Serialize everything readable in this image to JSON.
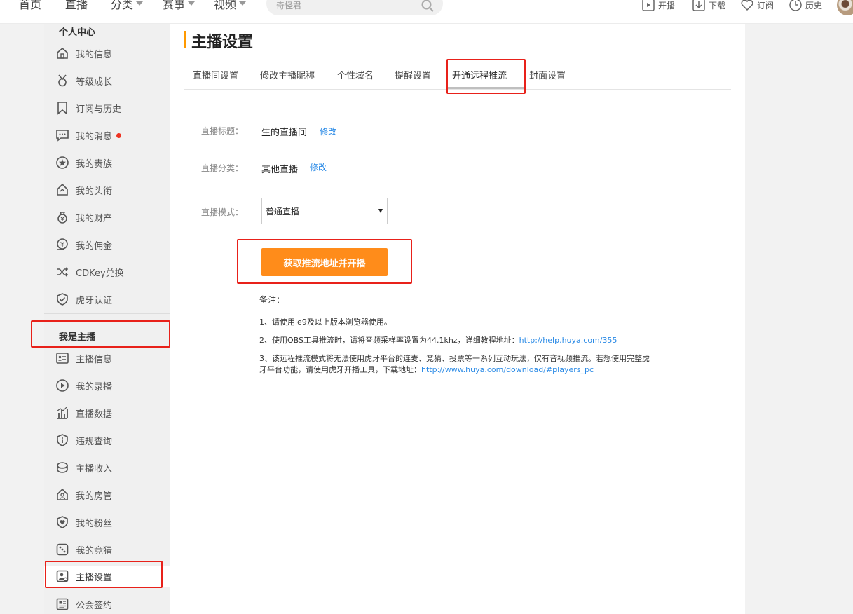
{
  "topnav": {
    "home": "首页",
    "live": "直播",
    "category": "分类",
    "events": "赛事",
    "video": "视频",
    "search_placeholder": "奇怪君",
    "start_live": "开播",
    "download": "下载",
    "subscribe": "订阅",
    "history": "历史"
  },
  "sidebar": {
    "personal_title": "个人中心",
    "personal_items": [
      {
        "label": "我的信息",
        "icon": "home-icon"
      },
      {
        "label": "等级成长",
        "icon": "medal-icon"
      },
      {
        "label": "订阅与历史",
        "icon": "bookmark-icon"
      },
      {
        "label": "我的消息",
        "icon": "message-icon"
      },
      {
        "label": "我的贵族",
        "icon": "star-icon"
      },
      {
        "label": "我的头衔",
        "icon": "house-icon"
      },
      {
        "label": "我的财产",
        "icon": "moneybag-icon"
      },
      {
        "label": "我的佣金",
        "icon": "commission-icon"
      },
      {
        "label": "CDKey兑换",
        "icon": "shuffle-icon"
      },
      {
        "label": "虎牙认证",
        "icon": "shield-check-icon"
      }
    ],
    "streamer_title": "我是主播",
    "streamer_items": [
      {
        "label": "主播信息",
        "icon": "id-card-icon"
      },
      {
        "label": "我的录播",
        "icon": "play-icon"
      },
      {
        "label": "直播数据",
        "icon": "bar-chart-icon"
      },
      {
        "label": "违规查询",
        "icon": "info-icon"
      },
      {
        "label": "主播收入",
        "icon": "income-icon"
      },
      {
        "label": "我的房管",
        "icon": "house-manager-icon"
      },
      {
        "label": "我的粉丝",
        "icon": "heart-shield-icon"
      },
      {
        "label": "我的竞猜",
        "icon": "dice-icon"
      },
      {
        "label": "主播设置",
        "icon": "user-settings-icon"
      },
      {
        "label": "公会签约",
        "icon": "contract-icon"
      }
    ]
  },
  "main": {
    "title": "主播设置",
    "tabs": [
      "直播间设置",
      "修改主播昵称",
      "个性域名",
      "提醒设置",
      "开通远程推流",
      "封面设置"
    ],
    "active_tab": "开通远程推流",
    "form": {
      "title_label": "直播标题：",
      "title_value": "生的直播间",
      "category_label": "直播分类：",
      "category_value": "其他直播",
      "edit_label": "修改",
      "mode_label": "直播模式：",
      "mode_value": "普通直播"
    },
    "button_label": "获取推流地址并开播",
    "notes": {
      "title": "备注：",
      "item1": "1、请使用ie9及以上版本浏览器使用。",
      "item2_text": "2、使用OBS工具推流时，请将音频采样率设置为44.1khz，详细教程地址：",
      "item2_link": "http://help.huya.com/355",
      "item3_text": "3、该远程推流模式将无法使用虎牙平台的连麦、竞猜、投票等一系列互动玩法，仅有音视频推流。若想使用完整虎牙平台功能，请使用虎牙开播工具，下载地址：",
      "item3_link": "http://www.huya.com/download/#players_pc"
    }
  },
  "colors": {
    "accent": "#ff8c1a",
    "link": "#2a8ae6",
    "highlight": "#e8211a",
    "notification_dot": "#ee3322"
  }
}
